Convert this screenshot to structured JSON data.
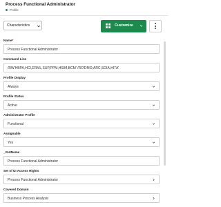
{
  "header": {
    "title": "Process Functional Administrator",
    "breadcrumb": "Profile"
  },
  "toolbar": {
    "characteristics_label": "Characteristics",
    "customize_label": "Customize"
  },
  "fields": [
    {
      "label": "Name",
      "required": "*",
      "value": "Process Functional Administrator",
      "kind": "text"
    },
    {
      "label": "Command Line",
      "value": "/RW'HBPA,HCI,ERML,SUP,PPM,HSIM,BCM' /RO'DMO,ARC,SOIA,HITA'",
      "kind": "text"
    },
    {
      "label": "Profile Display",
      "value": "Always",
      "kind": "select"
    },
    {
      "label": "Profile Status",
      "value": "Active",
      "kind": "select"
    },
    {
      "label": "Administrator Profile",
      "value": "Functional",
      "kind": "select"
    },
    {
      "label": "Assignable",
      "value": "Yes",
      "kind": "select"
    },
    {
      "label": "_GUIName",
      "value": "Process Functional Administrator",
      "kind": "text"
    },
    {
      "label": "Set of UI Access Rights",
      "value": "Process Functional Administrator",
      "kind": "link"
    },
    {
      "label": "Covered Domain",
      "value": "Business Process Analysis",
      "kind": "link"
    }
  ],
  "colors": {
    "accent": "#1b8a4c",
    "status_dot": "#2e8b57"
  }
}
